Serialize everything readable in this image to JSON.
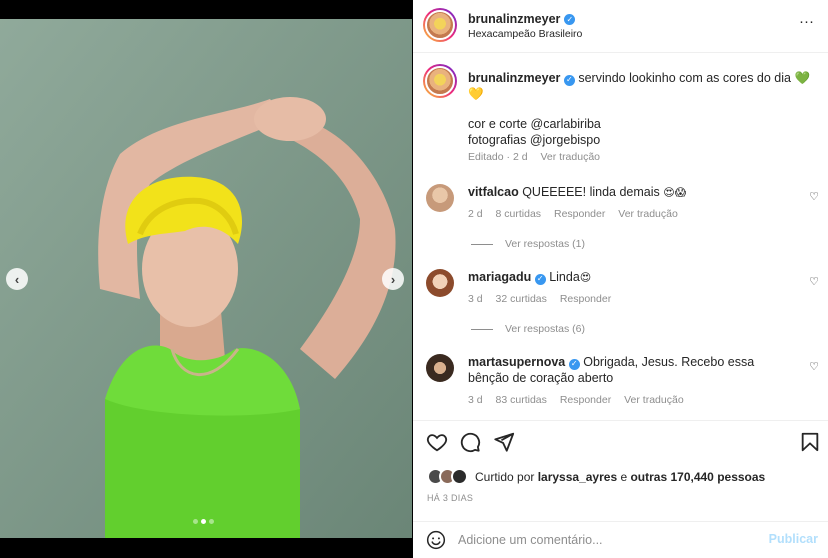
{
  "post": {
    "username": "brunalinzmeyer",
    "subtitle": "Hexacampeão Brasileiro",
    "verified_glyph": "✓",
    "more_glyph": "···",
    "media_nav": {
      "prev": "‹",
      "next": "›"
    },
    "media_page": {
      "current": 2,
      "total": 3
    }
  },
  "caption": {
    "username": "brunalinzmeyer",
    "text": "servindo lookinho com as cores do dia",
    "emoji_green": "💚",
    "emoji_yellow": "💛",
    "line1": "cor e corte @carlabiriba",
    "line2": "fotografias @jorgebispo",
    "edited": "Editado · 2 d",
    "see_translation": "Ver tradução"
  },
  "comments": [
    {
      "username": "vitfalcao",
      "text": "QUEEEEE! linda demais",
      "emojis": "😍😱",
      "time": "2 d",
      "likes": "8 curtidas",
      "reply": "Responder",
      "translate": "Ver tradução",
      "replies": "Ver respostas (1)",
      "verified": false
    },
    {
      "username": "mariagadu",
      "text": "Linda",
      "emojis": "😍",
      "time": "3 d",
      "likes": "32 curtidas",
      "reply": "Responder",
      "replies": "Ver respostas (6)",
      "verified": true
    },
    {
      "username": "martasupernova",
      "text": "Obrigada, Jesus. Recebo essa bênção de coração aberto",
      "time": "3 d",
      "likes": "83 curtidas",
      "reply": "Responder",
      "translate": "Ver tradução",
      "verified": true
    }
  ],
  "actions": {
    "liked_by_prefix": "Curtido por ",
    "liked_by_user": "laryssa_ayres",
    "liked_by_mid": " e ",
    "liked_by_others": "outras 170,440 pessoas",
    "date_ago": "HÁ 3 DIAS"
  },
  "composer": {
    "placeholder": "Adicione um comentário...",
    "post_label": "Publicar"
  },
  "colors": {
    "verified": "#3897f0",
    "post_button_disabled": "#b2dffc",
    "meta_text": "#8e8e8e"
  }
}
